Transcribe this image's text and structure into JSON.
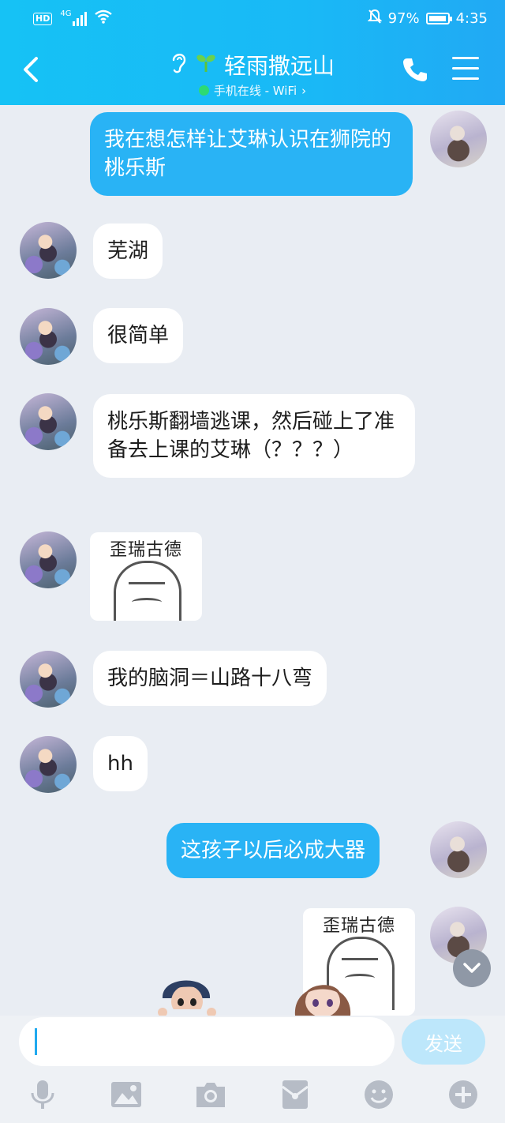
{
  "status_bar": {
    "network": "4G",
    "hd_badge": "HD",
    "battery_text": "97%",
    "battery_level": 0.97,
    "time": "4:35"
  },
  "header": {
    "contact_name": "轻雨撒远山",
    "subtitle": "手机在线 - WiFi",
    "colors": {
      "header": "#19b9f6",
      "online_dot": "#2fdc6c"
    }
  },
  "messages": [
    {
      "side": "out",
      "type": "text",
      "text": "我在想怎样让艾琳认识在狮院的桃乐斯"
    },
    {
      "side": "in",
      "type": "text",
      "text": "芜湖"
    },
    {
      "side": "in",
      "type": "text",
      "text": "很简单"
    },
    {
      "side": "in",
      "type": "text",
      "text": "桃乐斯翻墙逃课，然后碰上了准备去上课的艾琳（？？？）"
    },
    {
      "side": "in",
      "type": "sticker",
      "caption": "歪瑞古德"
    },
    {
      "side": "in",
      "type": "text",
      "text": "我的脑洞＝山路十八弯"
    },
    {
      "side": "in",
      "type": "text",
      "text": "hh"
    },
    {
      "side": "out",
      "type": "text",
      "text": "这孩子以后必成大器"
    },
    {
      "side": "out",
      "type": "sticker",
      "caption": "歪瑞古德"
    }
  ],
  "input": {
    "value": "",
    "send_label": "发送"
  },
  "toolbar": [
    {
      "icon": "microphone-icon"
    },
    {
      "icon": "image-icon"
    },
    {
      "icon": "camera-icon"
    },
    {
      "icon": "red-packet-icon"
    },
    {
      "icon": "emoji-icon"
    },
    {
      "icon": "plus-icon"
    }
  ],
  "colors": {
    "out_bubble": "#29b3f5",
    "in_bubble": "#ffffff",
    "background": "#e9edf3",
    "send_button": "#bde7fb"
  }
}
